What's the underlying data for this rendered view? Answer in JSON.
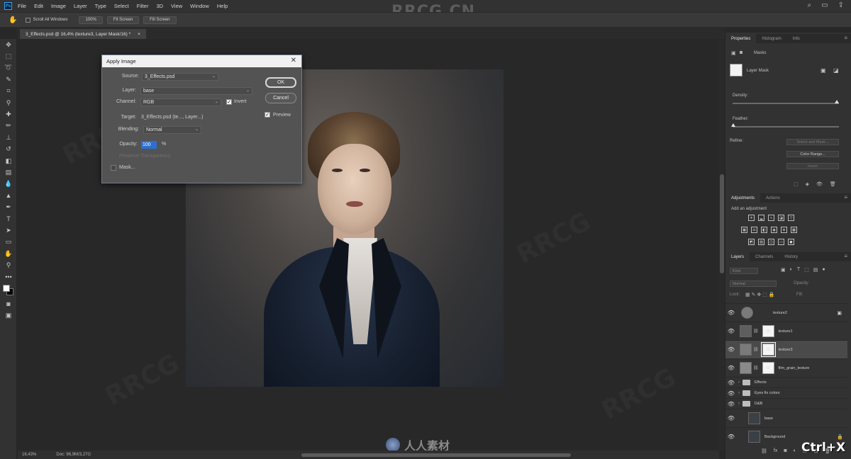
{
  "menubar": {
    "logo": "Ps",
    "items": [
      "File",
      "Edit",
      "Image",
      "Layer",
      "Type",
      "Select",
      "Filter",
      "3D",
      "View",
      "Window",
      "Help"
    ],
    "watermark": "RRCG.CN"
  },
  "options": {
    "scroll_all": "Scroll All Windows",
    "zoom": "100%",
    "fit_screen": "Fit Screen",
    "fill_screen": "Fill Screen"
  },
  "document": {
    "tab_title": "3_Effects.psd @ 16,4% (texture3, Layer Mask/16) *",
    "close": "×"
  },
  "dialog": {
    "title": "Apply Image",
    "close": "✕",
    "source_label": "Source:",
    "source_value": "3_Effects.psd",
    "layer_label": "Layer:",
    "layer_value": "base",
    "channel_label": "Channel:",
    "channel_value": "RGB",
    "invert_label": "Invert",
    "invert_checked": true,
    "target_label": "Target:",
    "target_value": "3_Effects.psd (te..., Layer...)",
    "blending_label": "Blending:",
    "blending_value": "Normal",
    "opacity_label": "Opacity:",
    "opacity_value": "100",
    "opacity_unit": "%",
    "preserve_label": "Preserve Transparency",
    "mask_label": "Mask...",
    "ok_label": "OK",
    "cancel_label": "Cancel",
    "preview_label": "Preview",
    "preview_checked": true
  },
  "properties": {
    "tabs": [
      "Properties",
      "Histogram",
      "Info"
    ],
    "header": "Masks",
    "layer_mask": "Layer Mask",
    "density_label": "Density:",
    "density_value": 100,
    "feather_label": "Feather:",
    "feather_value": 0,
    "refine_label": "Refine:",
    "select_mask_btn": "Select and Mask...",
    "color_range_btn": "Color Range...",
    "invert_btn": "Invert"
  },
  "adjustments": {
    "tabs": [
      "Adjustments",
      "Actions"
    ],
    "add_label": "Add an adjustment"
  },
  "layers": {
    "tabs": [
      "Layers",
      "Channels",
      "History"
    ],
    "kind_filter": "Kind",
    "blend_mode": "Normal",
    "opacity": "Opacity:",
    "fill": "Fill:",
    "lock": "Lock:",
    "items": [
      {
        "name": "texture2",
        "kind": "smart"
      },
      {
        "name": "texture1",
        "kind": "masked"
      },
      {
        "name": "texture3",
        "kind": "masked",
        "selected": true
      },
      {
        "name": "film_grain_texture",
        "kind": "masked"
      },
      {
        "name": "Effects",
        "kind": "group"
      },
      {
        "name": "Eyes fix colors",
        "kind": "group"
      },
      {
        "name": "D&B",
        "kind": "group"
      },
      {
        "name": "base",
        "kind": "photo"
      },
      {
        "name": "Background",
        "kind": "background"
      }
    ]
  },
  "status": {
    "zoom": "16,43%",
    "doc": "Doc: 96,9M/3,27G"
  },
  "overlay": {
    "bottom_watermark": "人人素材",
    "shortcut": "Ctrl+X"
  },
  "colors": {
    "accent": "#31a8ff",
    "highlight": "#2d6fd1",
    "panel_bg": "#323232"
  }
}
